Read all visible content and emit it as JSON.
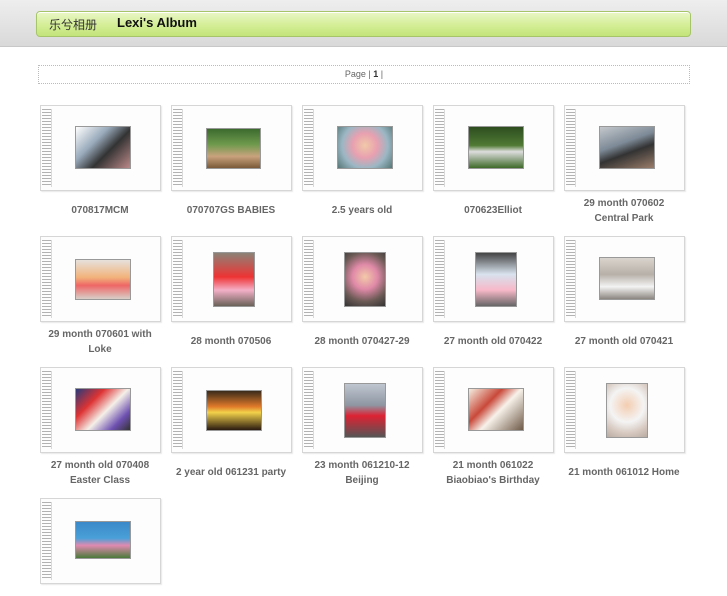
{
  "header": {
    "site_name": "乐兮相册",
    "album_title": "Lexi's Album"
  },
  "pager": {
    "label": "Page |",
    "current": "1",
    "trailing": "|"
  },
  "albums": [
    {
      "caption_line1": "070817MCM",
      "caption_line2": ""
    },
    {
      "caption_line1": "070707GS BABIES",
      "caption_line2": ""
    },
    {
      "caption_line1": "2.5 years old",
      "caption_line2": ""
    },
    {
      "caption_line1": "070623Elliot",
      "caption_line2": ""
    },
    {
      "caption_line1": "29 month 070602",
      "caption_line2": "Central Park"
    },
    {
      "caption_line1": "29 month 070601 with",
      "caption_line2": "Loke"
    },
    {
      "caption_line1": "28 month 070506",
      "caption_line2": ""
    },
    {
      "caption_line1": "28 month 070427-29",
      "caption_line2": ""
    },
    {
      "caption_line1": "27 month old 070422",
      "caption_line2": ""
    },
    {
      "caption_line1": "27 month old 070421",
      "caption_line2": ""
    },
    {
      "caption_line1": "27 month old 070408",
      "caption_line2": "Easter Class"
    },
    {
      "caption_line1": "2 year old 061231 party",
      "caption_line2": ""
    },
    {
      "caption_line1": "23 month 061210-12",
      "caption_line2": "Beijing"
    },
    {
      "caption_line1": "21 month 061022",
      "caption_line2": "Biaobiao's Birthday"
    },
    {
      "caption_line1": "21 month 061012 Home",
      "caption_line2": ""
    },
    {
      "caption_line1": "",
      "caption_line2": ""
    }
  ],
  "colors": {
    "title_bar": "#d4ee96",
    "caption_text": "#666666"
  }
}
